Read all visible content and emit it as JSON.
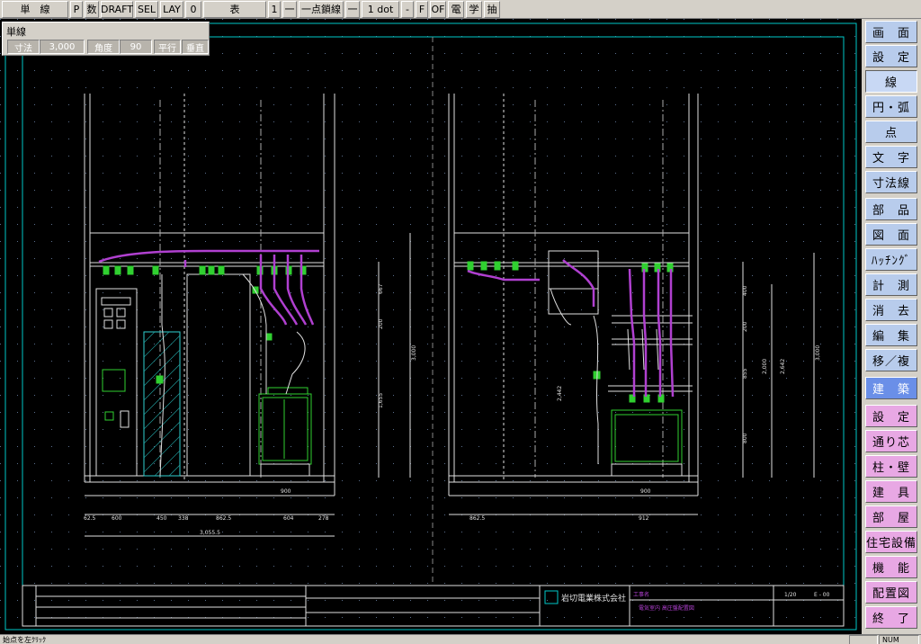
{
  "toolbar": {
    "items": [
      "単　線",
      "P",
      "数",
      "DRAFT",
      "SEL",
      "LAY",
      "0",
      "表",
      "1",
      "一",
      "一点鎖線",
      "一",
      "1 dot",
      "-",
      "F",
      "OF",
      "電",
      "学",
      "抽"
    ]
  },
  "panel": {
    "title": "単線",
    "dim_label": "寸法",
    "dim_value": "3,000",
    "angle_label": "角度",
    "angle_value": "90",
    "parallel": "平行",
    "vertical": "垂直"
  },
  "menu": {
    "top": [
      "画　面",
      "設　定",
      "線",
      "円・弧",
      "点",
      "文　字",
      "寸法線",
      "部　品",
      "図　面",
      "ﾊｯﾁﾝｸﾞ",
      "計　測",
      "消　去",
      "編　集",
      "移／複"
    ],
    "selected": "線",
    "section": "建　築",
    "bottom": [
      "設　定",
      "通り芯",
      "柱・壁",
      "建　具",
      "部　屋",
      "住宅設備",
      "機　能",
      "配置図",
      "終　了"
    ]
  },
  "status": {
    "hint": "始点を左ｸﾘｯｸ",
    "num": "NUM"
  },
  "drawing": {
    "company": "岩切電業株式会社",
    "left_dims": {
      "bottom_segments": [
        "62.5",
        "600",
        "450",
        "338",
        "862.5",
        "604",
        "278"
      ],
      "total": "3,055.5",
      "inner": "900",
      "vertical": [
        "667",
        "200",
        "1,655",
        "3,000"
      ]
    },
    "right_dims": {
      "bottom_segments": [
        "862.5",
        "912"
      ],
      "inner": "900",
      "vertical": [
        "400",
        "200",
        "855",
        "800",
        "2,000",
        "2,642",
        "3,000",
        "2,442"
      ]
    },
    "title_block": {
      "label1": "工事名",
      "value1": "電気室内 高圧盤配置図",
      "scale": "1/20",
      "sheet": "E - 00"
    }
  },
  "colors": {
    "grid": "#5a6e8c",
    "frame": "#00c8c8",
    "line": "#e0e0e0",
    "cable": "#b040d0",
    "equipment": "#30d030",
    "menu_blue": "#b8ccec",
    "menu_pink": "#e8a8e4",
    "menu_header": "#6a8fe8"
  }
}
